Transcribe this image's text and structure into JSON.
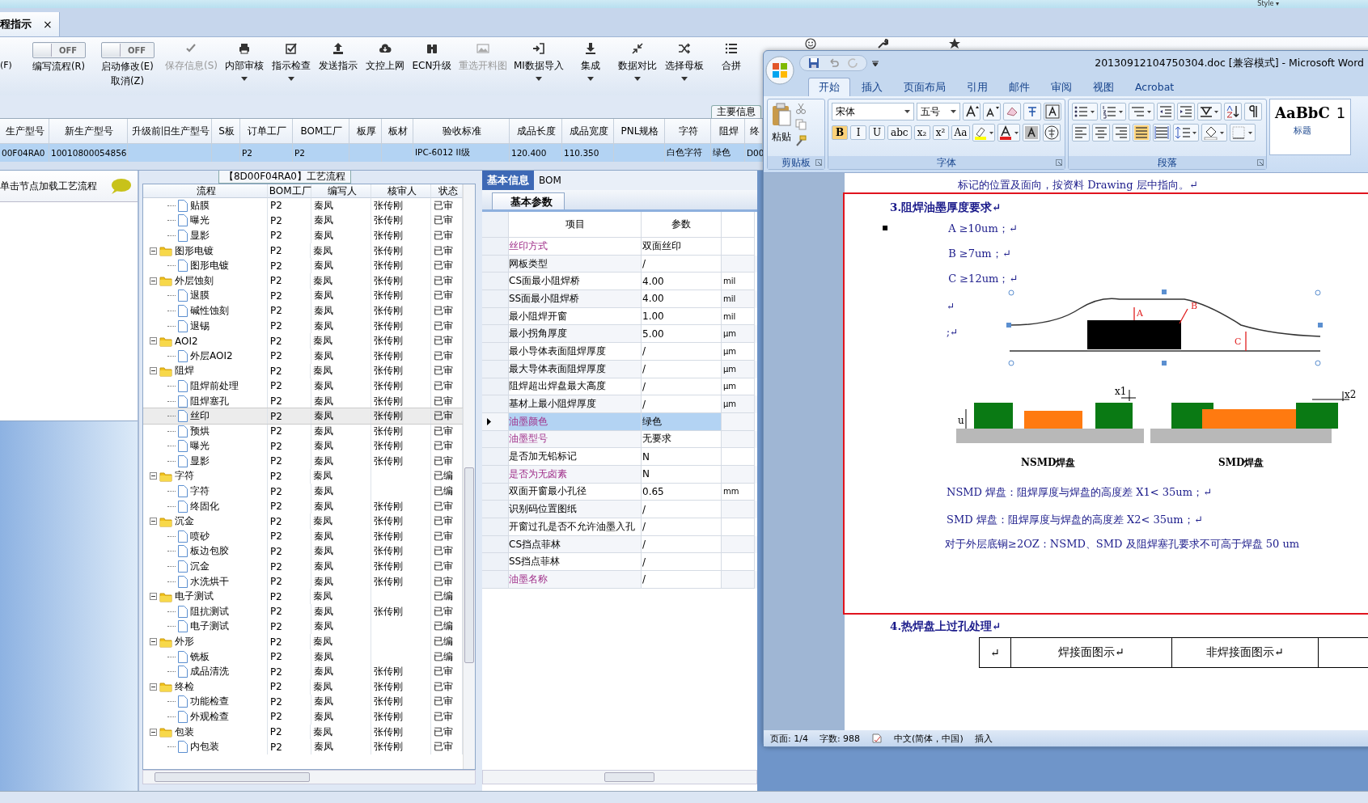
{
  "top_strip": {
    "style_menu": "Style ▾"
  },
  "doc_tab": {
    "label": "程指示",
    "close": "×"
  },
  "toolbar": {
    "items": [
      {
        "kind": "text",
        "label": "(F)"
      },
      {
        "kind": "toggle",
        "on": false,
        "state_text": "OFF",
        "label": "编写流程(R)"
      },
      {
        "kind": "toggle",
        "on": false,
        "state_text": "OFF",
        "label": "启动修改(E)",
        "sub_label": "取消(Z)"
      },
      {
        "kind": "button",
        "label": "保存信息(S)",
        "disabled": true,
        "dropdown": false
      },
      {
        "kind": "button",
        "label": "内部审核",
        "disabled": false,
        "dropdown": true
      },
      {
        "kind": "button",
        "label": "指示检查",
        "disabled": false,
        "dropdown": true
      },
      {
        "kind": "button",
        "label": "发送指示",
        "disabled": false,
        "dropdown": false
      },
      {
        "kind": "button",
        "label": "文控上网",
        "disabled": false,
        "dropdown": false
      },
      {
        "kind": "button",
        "label": "ECN升级",
        "disabled": false,
        "dropdown": false
      },
      {
        "kind": "button",
        "label": "重选开料图",
        "disabled": true,
        "dropdown": false
      },
      {
        "kind": "button",
        "label": "MI数据导入",
        "disabled": false,
        "dropdown": true
      },
      {
        "kind": "button",
        "label": "集成",
        "disabled": false,
        "dropdown": true
      },
      {
        "kind": "button",
        "label": "数据对比",
        "disabled": false,
        "dropdown": true
      },
      {
        "kind": "button",
        "label": "选择母板",
        "disabled": false,
        "dropdown": true
      },
      {
        "kind": "button",
        "label": "合拼",
        "disabled": false,
        "dropdown": false
      }
    ]
  },
  "main_info": {
    "group_label": "主要信息",
    "columns": [
      "生产型号",
      "新生产型号",
      "升级前旧生产型号",
      "S板",
      "订单工厂",
      "BOM工厂",
      "板厚",
      "板材",
      "验收标准",
      "成品长度",
      "成品宽度",
      "PNL规格",
      "字符",
      "阻焊",
      "终"
    ],
    "rows": [
      {
        "selected": true,
        "cells": [
          "00F04RA0",
          "10010800054856",
          "",
          "",
          "P2",
          "P2",
          "",
          "",
          "IPC-6012 II级",
          "120.400",
          "110.350",
          "",
          "白色字符",
          "绿色",
          "D00"
        ]
      }
    ]
  },
  "process_panel": {
    "title": "【8D00F04RA0】工艺流程",
    "hint": "单击节点加载工艺流程",
    "tree": {
      "columns": [
        "流程",
        "BOM工厂",
        "编写人",
        "核审人",
        "状态"
      ],
      "nodes": [
        {
          "children": [
            {
              "label": "贴膜",
              "bom": "P2",
              "writer": "秦凤",
              "reviewer": "张传刚",
              "status": "已审",
              "selected": false
            },
            {
              "label": "曝光",
              "bom": "P2",
              "writer": "秦凤",
              "reviewer": "张传刚",
              "status": "已审",
              "selected": false
            },
            {
              "label": "显影",
              "bom": "P2",
              "writer": "秦凤",
              "reviewer": "张传刚",
              "status": "已审",
              "selected": false
            }
          ]
        },
        {
          "label": "图形电镀",
          "bom": "P2",
          "writer": "秦凤",
          "reviewer": "张传刚",
          "status": "已审",
          "selected": false,
          "expanded": true,
          "children": [
            {
              "label": "图形电镀",
              "bom": "P2",
              "writer": "秦凤",
              "reviewer": "张传刚",
              "status": "已审",
              "selected": false
            }
          ]
        },
        {
          "label": "外层蚀刻",
          "bom": "P2",
          "writer": "秦凤",
          "reviewer": "张传刚",
          "status": "已审",
          "selected": false,
          "expanded": true,
          "children": [
            {
              "label": "退膜",
              "bom": "P2",
              "writer": "秦凤",
              "reviewer": "张传刚",
              "status": "已审",
              "selected": false
            },
            {
              "label": "碱性蚀刻",
              "bom": "P2",
              "writer": "秦凤",
              "reviewer": "张传刚",
              "status": "已审",
              "selected": false
            },
            {
              "label": "退锡",
              "bom": "P2",
              "writer": "秦凤",
              "reviewer": "张传刚",
              "status": "已审",
              "selected": false
            }
          ]
        },
        {
          "label": "AOI2",
          "bom": "P2",
          "writer": "秦凤",
          "reviewer": "张传刚",
          "status": "已审",
          "selected": false,
          "expanded": true,
          "children": [
            {
              "label": "外层AOI2",
              "bom": "P2",
              "writer": "秦凤",
              "reviewer": "张传刚",
              "status": "已审",
              "selected": false
            }
          ]
        },
        {
          "label": "阻焊",
          "bom": "P2",
          "writer": "秦凤",
          "reviewer": "张传刚",
          "status": "已审",
          "selected": false,
          "expanded": true,
          "children": [
            {
              "label": "阻焊前处理",
              "bom": "P2",
              "writer": "秦凤",
              "reviewer": "张传刚",
              "status": "已审",
              "selected": false
            },
            {
              "label": "阻焊塞孔",
              "bom": "P2",
              "writer": "秦凤",
              "reviewer": "张传刚",
              "status": "已审",
              "selected": false
            },
            {
              "label": "丝印",
              "bom": "P2",
              "writer": "秦凤",
              "reviewer": "张传刚",
              "status": "已审",
              "selected": true
            },
            {
              "label": "预烘",
              "bom": "P2",
              "writer": "秦凤",
              "reviewer": "张传刚",
              "status": "已审",
              "selected": false
            },
            {
              "label": "曝光",
              "bom": "P2",
              "writer": "秦凤",
              "reviewer": "张传刚",
              "status": "已审",
              "selected": false
            },
            {
              "label": "显影",
              "bom": "P2",
              "writer": "秦凤",
              "reviewer": "张传刚",
              "status": "已审",
              "selected": false
            }
          ]
        },
        {
          "label": "字符",
          "bom": "P2",
          "writer": "秦凤",
          "status": "已编",
          "selected": false,
          "expanded": true,
          "children": [
            {
              "label": "字符",
              "bom": "P2",
              "writer": "秦凤",
              "status": "已编",
              "selected": false
            },
            {
              "label": "终固化",
              "bom": "P2",
              "writer": "秦凤",
              "reviewer": "张传刚",
              "status": "已审",
              "selected": false
            }
          ]
        },
        {
          "label": "沉金",
          "bom": "P2",
          "writer": "秦凤",
          "reviewer": "张传刚",
          "status": "已审",
          "selected": false,
          "expanded": true,
          "children": [
            {
              "label": "喷砂",
              "bom": "P2",
              "writer": "秦凤",
              "reviewer": "张传刚",
              "status": "已审",
              "selected": false
            },
            {
              "label": "板边包胶",
              "bom": "P2",
              "writer": "秦凤",
              "reviewer": "张传刚",
              "status": "已审",
              "selected": false
            },
            {
              "label": "沉金",
              "bom": "P2",
              "writer": "秦凤",
              "reviewer": "张传刚",
              "status": "已审",
              "selected": false
            },
            {
              "label": "水洗烘干",
              "bom": "P2",
              "writer": "秦凤",
              "reviewer": "张传刚",
              "status": "已审",
              "selected": false
            }
          ]
        },
        {
          "label": "电子测试",
          "bom": "P2",
          "writer": "秦凤",
          "status": "已编",
          "selected": false,
          "expanded": true,
          "children": [
            {
              "label": "阻抗测试",
              "bom": "P2",
              "writer": "秦凤",
              "reviewer": "张传刚",
              "status": "已审",
              "selected": false
            },
            {
              "label": "电子测试",
              "bom": "P2",
              "writer": "秦凤",
              "status": "已编",
              "selected": false
            }
          ]
        },
        {
          "label": "外形",
          "bom": "P2",
          "writer": "秦凤",
          "status": "已编",
          "selected": false,
          "expanded": true,
          "children": [
            {
              "label": "铣板",
              "bom": "P2",
              "writer": "秦凤",
              "status": "已编",
              "selected": false
            },
            {
              "label": "成品清洗",
              "bom": "P2",
              "writer": "秦凤",
              "reviewer": "张传刚",
              "status": "已审",
              "selected": false
            }
          ]
        },
        {
          "label": "终检",
          "bom": "P2",
          "writer": "秦凤",
          "reviewer": "张传刚",
          "status": "已审",
          "selected": false,
          "expanded": true,
          "children": [
            {
              "label": "功能检查",
              "bom": "P2",
              "writer": "秦凤",
              "reviewer": "张传刚",
              "status": "已审",
              "selected": false
            },
            {
              "label": "外观检查",
              "bom": "P2",
              "writer": "秦凤",
              "reviewer": "张传刚",
              "status": "已审",
              "selected": false
            }
          ]
        },
        {
          "label": "包装",
          "bom": "P2",
          "writer": "秦凤",
          "reviewer": "张传刚",
          "status": "已审",
          "selected": false,
          "expanded": true,
          "children": [
            {
              "label": "内包装",
              "bom": "P2",
              "writer": "秦凤",
              "reviewer": "张传刚",
              "status": "已审",
              "selected": false
            }
          ]
        }
      ]
    }
  },
  "params_panel": {
    "tabs": [
      {
        "label": "基本信息",
        "selected": true
      },
      {
        "label": "BOM",
        "selected": false
      }
    ],
    "subtab": "基本参数",
    "columns": [
      "项目",
      "参数"
    ],
    "rows": [
      {
        "item": "丝印方式",
        "value": "双面丝印",
        "flagged": true,
        "selected": false
      },
      {
        "item": "网板类型",
        "value": "/",
        "flagged": false,
        "selected": false
      },
      {
        "item": "CS面最小阻焊桥",
        "value": "4.00",
        "unit": "mil",
        "flagged": false,
        "selected": false
      },
      {
        "item": "SS面最小阻焊桥",
        "value": "4.00",
        "unit": "mil",
        "flagged": false,
        "selected": false
      },
      {
        "item": "最小阻焊开窗",
        "value": "1.00",
        "unit": "mil",
        "flagged": false,
        "selected": false
      },
      {
        "item": "最小拐角厚度",
        "value": "5.00",
        "unit": "μm",
        "flagged": false,
        "selected": false
      },
      {
        "item": "最小导体表面阻焊厚度",
        "value": "/",
        "unit": "μm",
        "flagged": false,
        "selected": false
      },
      {
        "item": "最大导体表面阻焊厚度",
        "value": "/",
        "unit": "μm",
        "flagged": false,
        "selected": false
      },
      {
        "item": "阻焊超出焊盘最大高度",
        "value": "/",
        "unit": "μm",
        "flagged": false,
        "selected": false
      },
      {
        "item": "基材上最小阻焊厚度",
        "value": "/",
        "unit": "μm",
        "flagged": false,
        "selected": false
      },
      {
        "item": "油墨颜色",
        "value": "绿色",
        "flagged": true,
        "selected": true
      },
      {
        "item": "油墨型号",
        "value": "无要求",
        "flagged": true,
        "selected": false
      },
      {
        "item": "是否加无铅标记",
        "value": "N",
        "flagged": false,
        "selected": false
      },
      {
        "item": "是否为无卤素",
        "value": "N",
        "flagged": true,
        "selected": false
      },
      {
        "item": "双面开窗最小孔径",
        "value": "0.65",
        "unit": "mm",
        "flagged": false,
        "selected": false
      },
      {
        "item": "识别码位置图纸",
        "value": "/",
        "flagged": false,
        "selected": false
      },
      {
        "item": "开窗过孔是否不允许油墨入孔",
        "value": "/",
        "flagged": false,
        "selected": false
      },
      {
        "item": "CS挡点菲林",
        "value": "/",
        "flagged": false,
        "selected": false
      },
      {
        "item": "SS挡点菲林",
        "value": "/",
        "flagged": false,
        "selected": false
      },
      {
        "item": "油墨名称",
        "value": "/",
        "flagged": true,
        "selected": false
      }
    ]
  },
  "word": {
    "title": "20130912104750304.doc [兼容模式] - Microsoft Word",
    "tabs": [
      {
        "label": "开始",
        "selected": true
      },
      {
        "label": "插入",
        "selected": false
      },
      {
        "label": "页面布局",
        "selected": false
      },
      {
        "label": "引用",
        "selected": false
      },
      {
        "label": "邮件",
        "selected": false
      },
      {
        "label": "审阅",
        "selected": false
      },
      {
        "label": "视图",
        "selected": false
      },
      {
        "label": "Acrobat",
        "selected": false
      }
    ],
    "ribbon": {
      "paste": "粘贴",
      "font_name": "宋体",
      "font_size": "五号",
      "format_buttons": [
        {
          "label": "B",
          "on": true
        },
        {
          "label": "I",
          "on": false
        },
        {
          "label": "U",
          "on": false
        },
        {
          "label": "abc",
          "on": false
        },
        {
          "label": "x₂",
          "on": false
        },
        {
          "label": "x²",
          "on": false
        },
        {
          "label": "Aa",
          "on": false
        }
      ],
      "groups": [
        "剪贴板",
        "字体",
        "段落"
      ],
      "style_sample": "AaBbC",
      "style_name": "标题",
      "style_next": "1"
    },
    "document": {
      "lead": "标记的位置及面向，按资料 Drawing 层中指向。↵",
      "heading": "3.阻焊油墨厚度要求↵",
      "bullet": "▪",
      "requirements": [
        "A ≥10um；↵",
        "B ≥7um；↵",
        "C ≥12um；↵"
      ],
      "para_marks": [
        "↵",
        ";↵"
      ],
      "diagram": {
        "profile_labels": [
          "A",
          "B",
          "C"
        ],
        "gap_labels": [
          "x1",
          "x2"
        ],
        "height_label": "u",
        "captions": [
          "NSMD焊盘",
          "SMD焊盘"
        ]
      },
      "notes": [
        "NSMD 焊盘：阻焊厚度与焊盘的高度差 X1< 35um；↵",
        "SMD 焊盘：阻焊厚度与焊盘的高度差 X2< 35um；↵"
      ],
      "last_note": "对于外层底铜≥2OZ：NSMD、SMD 及阻焊塞孔要求不可高于焊盘 50 um",
      "heading2": "4.热焊盘上过孔处理↵",
      "table_cells": [
        "↵",
        "焊接面图示↵",
        "非焊接面图示↵"
      ]
    },
    "status": {
      "page": "页面: 1/4",
      "words": "字数: 988",
      "language": "中文(简体，中国)",
      "mode": "插入"
    }
  }
}
